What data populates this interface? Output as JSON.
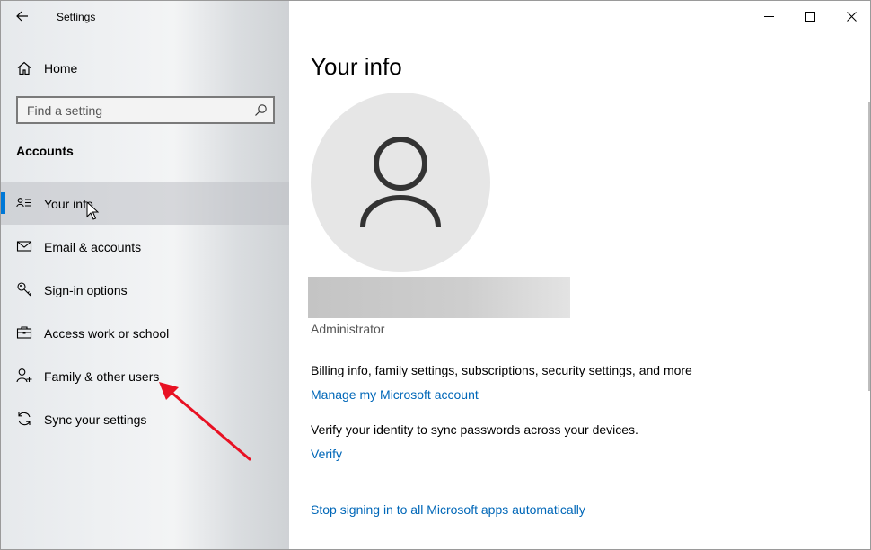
{
  "window": {
    "title": "Settings"
  },
  "sidebar": {
    "home_label": "Home",
    "search": {
      "placeholder": "Find a setting"
    },
    "section_heading": "Accounts",
    "items": [
      {
        "label": "Your info",
        "icon": "contact-card-icon",
        "active": true
      },
      {
        "label": "Email & accounts",
        "icon": "mail-icon",
        "active": false
      },
      {
        "label": "Sign-in options",
        "icon": "key-icon",
        "active": false
      },
      {
        "label": "Access work or school",
        "icon": "briefcase-icon",
        "active": false
      },
      {
        "label": "Family & other users",
        "icon": "add-person-icon",
        "active": false
      },
      {
        "label": "Sync your settings",
        "icon": "sync-icon",
        "active": false
      }
    ]
  },
  "main": {
    "title": "Your info",
    "account_role": "Administrator",
    "billing_text": "Billing info, family settings, subscriptions, security settings, and more",
    "manage_link": "Manage my Microsoft account",
    "verify_text": "Verify your identity to sync passwords across your devices.",
    "verify_link": "Verify",
    "stop_link": "Stop signing in to all Microsoft apps automatically"
  },
  "colors": {
    "accent": "#0078d7",
    "link": "#0067b8",
    "annotation_arrow": "#e81123"
  }
}
